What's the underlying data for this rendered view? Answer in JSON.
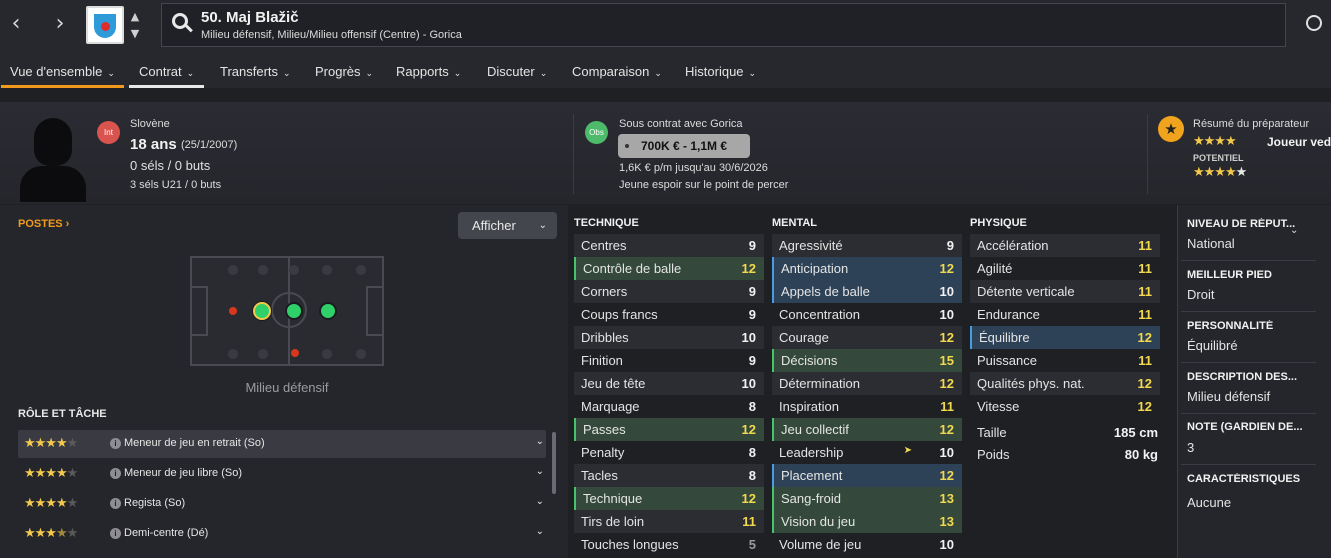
{
  "topbar": {
    "player_name": "50. Maj Blažič",
    "positions": "Milieu défensif, Milieu/Milieu offensif (Centre) - Gorica",
    "icons": [
      "back-arrow-icon",
      "forward-arrow-icon",
      "club-crest-icon",
      "search-icon",
      "globe-icon"
    ]
  },
  "tabs": [
    {
      "label": "Vue d'ensemble"
    },
    {
      "label": "Contrat"
    },
    {
      "label": "Transferts"
    },
    {
      "label": "Progrès"
    },
    {
      "label": "Rapports"
    },
    {
      "label": "Discuter"
    },
    {
      "label": "Comparaison"
    },
    {
      "label": "Historique"
    }
  ],
  "header": {
    "int_badge": "Int",
    "nationality": "Slovène",
    "age": "18 ans",
    "dob": "(25/1/2007)",
    "caps": "0 séls / 0 buts",
    "u21_caps": "3 séls U21 / 0 buts",
    "obs_badge": "Obs",
    "contract": "Sous contrat avec Gorica",
    "value": "700K € - 1,1M €",
    "wage": "1,6K € p/m jusqu'au 30/6/2026",
    "status": "Jeune espoir sur le point de percer",
    "coach_title": "Résumé du préparateur",
    "coach_role": "Joueur ved",
    "potential_label": "POTENTIEL",
    "current_stars": 4,
    "potential_stars": 4.5
  },
  "positions_panel": {
    "title": "POSTES",
    "show_button": "Afficher",
    "caption": "Milieu défensif"
  },
  "roles": {
    "title": "RÔLE ET TÂCHE",
    "items": [
      {
        "name": "Meneur de jeu en retrait (So)",
        "stars": 4
      },
      {
        "name": "Meneur de jeu libre (So)",
        "stars": 4
      },
      {
        "name": "Regista (So)",
        "stars": 4
      },
      {
        "name": "Demi-centre (Dé)",
        "stars": 3.5
      }
    ]
  },
  "technique": {
    "title": "TECHNIQUE",
    "attrs": [
      {
        "name": "Centres",
        "value": "9"
      },
      {
        "name": "Contrôle de balle",
        "value": "12"
      },
      {
        "name": "Corners",
        "value": "9"
      },
      {
        "name": "Coups francs",
        "value": "9"
      },
      {
        "name": "Dribbles",
        "value": "10"
      },
      {
        "name": "Finition",
        "value": "9"
      },
      {
        "name": "Jeu de tête",
        "value": "10"
      },
      {
        "name": "Marquage",
        "value": "8"
      },
      {
        "name": "Passes",
        "value": "12"
      },
      {
        "name": "Penalty",
        "value": "8"
      },
      {
        "name": "Tacles",
        "value": "8"
      },
      {
        "name": "Technique",
        "value": "12"
      },
      {
        "name": "Tirs de loin",
        "value": "11"
      },
      {
        "name": "Touches longues",
        "value": "5"
      }
    ]
  },
  "mental": {
    "title": "MENTAL",
    "attrs": [
      {
        "name": "Agressivité",
        "value": "9"
      },
      {
        "name": "Anticipation",
        "value": "12"
      },
      {
        "name": "Appels de balle",
        "value": "10"
      },
      {
        "name": "Concentration",
        "value": "10"
      },
      {
        "name": "Courage",
        "value": "12"
      },
      {
        "name": "Décisions",
        "value": "15"
      },
      {
        "name": "Détermination",
        "value": "12"
      },
      {
        "name": "Inspiration",
        "value": "11"
      },
      {
        "name": "Jeu collectif",
        "value": "12"
      },
      {
        "name": "Leadership",
        "value": "10"
      },
      {
        "name": "Placement",
        "value": "12"
      },
      {
        "name": "Sang-froid",
        "value": "13"
      },
      {
        "name": "Vision du jeu",
        "value": "13"
      },
      {
        "name": "Volume de jeu",
        "value": "10"
      }
    ]
  },
  "physique": {
    "title": "PHYSIQUE",
    "attrs": [
      {
        "name": "Accélération",
        "value": "11"
      },
      {
        "name": "Agilité",
        "value": "11"
      },
      {
        "name": "Détente verticale",
        "value": "11"
      },
      {
        "name": "Endurance",
        "value": "11"
      },
      {
        "name": "Équilibre",
        "value": "12"
      },
      {
        "name": "Puissance",
        "value": "11"
      },
      {
        "name": "Qualités phys. nat.",
        "value": "12"
      },
      {
        "name": "Vitesse",
        "value": "12"
      }
    ],
    "height_label": "Taille",
    "height": "185 cm",
    "weight_label": "Poids",
    "weight": "80 kg"
  },
  "info": [
    {
      "label": "NIVEAU DE RÉPUT...",
      "value": "National"
    },
    {
      "label": "MEILLEUR PIED",
      "value": "Droit"
    },
    {
      "label": "PERSONNALITÉ",
      "value": "Équilibré"
    },
    {
      "label": "DESCRIPTION DES...",
      "value": "Milieu défensif"
    },
    {
      "label": "NOTE (GARDIEN DE...",
      "value": "3"
    },
    {
      "label": "CARACTÉRISTIQUES",
      "value": "Aucune"
    }
  ],
  "colors": {
    "accent": "#f29a1e",
    "highlight_green": "#34493c",
    "highlight_blue": "#2e4257",
    "value_yellow": "#f2d94e"
  }
}
